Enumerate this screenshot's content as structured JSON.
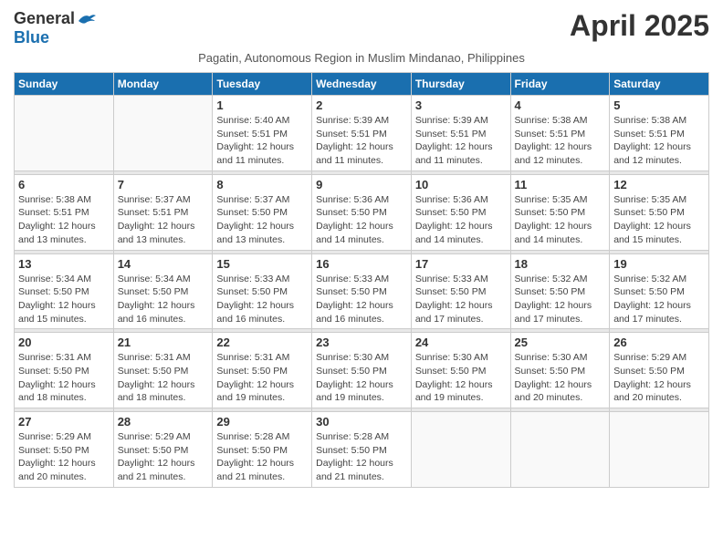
{
  "logo": {
    "general": "General",
    "blue": "Blue"
  },
  "title": "April 2025",
  "subtitle": "Pagatin, Autonomous Region in Muslim Mindanao, Philippines",
  "days_of_week": [
    "Sunday",
    "Monday",
    "Tuesday",
    "Wednesday",
    "Thursday",
    "Friday",
    "Saturday"
  ],
  "weeks": [
    [
      {
        "day": "",
        "sunrise": "",
        "sunset": "",
        "daylight": ""
      },
      {
        "day": "",
        "sunrise": "",
        "sunset": "",
        "daylight": ""
      },
      {
        "day": "1",
        "sunrise": "Sunrise: 5:40 AM",
        "sunset": "Sunset: 5:51 PM",
        "daylight": "Daylight: 12 hours and 11 minutes."
      },
      {
        "day": "2",
        "sunrise": "Sunrise: 5:39 AM",
        "sunset": "Sunset: 5:51 PM",
        "daylight": "Daylight: 12 hours and 11 minutes."
      },
      {
        "day": "3",
        "sunrise": "Sunrise: 5:39 AM",
        "sunset": "Sunset: 5:51 PM",
        "daylight": "Daylight: 12 hours and 11 minutes."
      },
      {
        "day": "4",
        "sunrise": "Sunrise: 5:38 AM",
        "sunset": "Sunset: 5:51 PM",
        "daylight": "Daylight: 12 hours and 12 minutes."
      },
      {
        "day": "5",
        "sunrise": "Sunrise: 5:38 AM",
        "sunset": "Sunset: 5:51 PM",
        "daylight": "Daylight: 12 hours and 12 minutes."
      }
    ],
    [
      {
        "day": "6",
        "sunrise": "Sunrise: 5:38 AM",
        "sunset": "Sunset: 5:51 PM",
        "daylight": "Daylight: 12 hours and 13 minutes."
      },
      {
        "day": "7",
        "sunrise": "Sunrise: 5:37 AM",
        "sunset": "Sunset: 5:51 PM",
        "daylight": "Daylight: 12 hours and 13 minutes."
      },
      {
        "day": "8",
        "sunrise": "Sunrise: 5:37 AM",
        "sunset": "Sunset: 5:50 PM",
        "daylight": "Daylight: 12 hours and 13 minutes."
      },
      {
        "day": "9",
        "sunrise": "Sunrise: 5:36 AM",
        "sunset": "Sunset: 5:50 PM",
        "daylight": "Daylight: 12 hours and 14 minutes."
      },
      {
        "day": "10",
        "sunrise": "Sunrise: 5:36 AM",
        "sunset": "Sunset: 5:50 PM",
        "daylight": "Daylight: 12 hours and 14 minutes."
      },
      {
        "day": "11",
        "sunrise": "Sunrise: 5:35 AM",
        "sunset": "Sunset: 5:50 PM",
        "daylight": "Daylight: 12 hours and 14 minutes."
      },
      {
        "day": "12",
        "sunrise": "Sunrise: 5:35 AM",
        "sunset": "Sunset: 5:50 PM",
        "daylight": "Daylight: 12 hours and 15 minutes."
      }
    ],
    [
      {
        "day": "13",
        "sunrise": "Sunrise: 5:34 AM",
        "sunset": "Sunset: 5:50 PM",
        "daylight": "Daylight: 12 hours and 15 minutes."
      },
      {
        "day": "14",
        "sunrise": "Sunrise: 5:34 AM",
        "sunset": "Sunset: 5:50 PM",
        "daylight": "Daylight: 12 hours and 16 minutes."
      },
      {
        "day": "15",
        "sunrise": "Sunrise: 5:33 AM",
        "sunset": "Sunset: 5:50 PM",
        "daylight": "Daylight: 12 hours and 16 minutes."
      },
      {
        "day": "16",
        "sunrise": "Sunrise: 5:33 AM",
        "sunset": "Sunset: 5:50 PM",
        "daylight": "Daylight: 12 hours and 16 minutes."
      },
      {
        "day": "17",
        "sunrise": "Sunrise: 5:33 AM",
        "sunset": "Sunset: 5:50 PM",
        "daylight": "Daylight: 12 hours and 17 minutes."
      },
      {
        "day": "18",
        "sunrise": "Sunrise: 5:32 AM",
        "sunset": "Sunset: 5:50 PM",
        "daylight": "Daylight: 12 hours and 17 minutes."
      },
      {
        "day": "19",
        "sunrise": "Sunrise: 5:32 AM",
        "sunset": "Sunset: 5:50 PM",
        "daylight": "Daylight: 12 hours and 17 minutes."
      }
    ],
    [
      {
        "day": "20",
        "sunrise": "Sunrise: 5:31 AM",
        "sunset": "Sunset: 5:50 PM",
        "daylight": "Daylight: 12 hours and 18 minutes."
      },
      {
        "day": "21",
        "sunrise": "Sunrise: 5:31 AM",
        "sunset": "Sunset: 5:50 PM",
        "daylight": "Daylight: 12 hours and 18 minutes."
      },
      {
        "day": "22",
        "sunrise": "Sunrise: 5:31 AM",
        "sunset": "Sunset: 5:50 PM",
        "daylight": "Daylight: 12 hours and 19 minutes."
      },
      {
        "day": "23",
        "sunrise": "Sunrise: 5:30 AM",
        "sunset": "Sunset: 5:50 PM",
        "daylight": "Daylight: 12 hours and 19 minutes."
      },
      {
        "day": "24",
        "sunrise": "Sunrise: 5:30 AM",
        "sunset": "Sunset: 5:50 PM",
        "daylight": "Daylight: 12 hours and 19 minutes."
      },
      {
        "day": "25",
        "sunrise": "Sunrise: 5:30 AM",
        "sunset": "Sunset: 5:50 PM",
        "daylight": "Daylight: 12 hours and 20 minutes."
      },
      {
        "day": "26",
        "sunrise": "Sunrise: 5:29 AM",
        "sunset": "Sunset: 5:50 PM",
        "daylight": "Daylight: 12 hours and 20 minutes."
      }
    ],
    [
      {
        "day": "27",
        "sunrise": "Sunrise: 5:29 AM",
        "sunset": "Sunset: 5:50 PM",
        "daylight": "Daylight: 12 hours and 20 minutes."
      },
      {
        "day": "28",
        "sunrise": "Sunrise: 5:29 AM",
        "sunset": "Sunset: 5:50 PM",
        "daylight": "Daylight: 12 hours and 21 minutes."
      },
      {
        "day": "29",
        "sunrise": "Sunrise: 5:28 AM",
        "sunset": "Sunset: 5:50 PM",
        "daylight": "Daylight: 12 hours and 21 minutes."
      },
      {
        "day": "30",
        "sunrise": "Sunrise: 5:28 AM",
        "sunset": "Sunset: 5:50 PM",
        "daylight": "Daylight: 12 hours and 21 minutes."
      },
      {
        "day": "",
        "sunrise": "",
        "sunset": "",
        "daylight": ""
      },
      {
        "day": "",
        "sunrise": "",
        "sunset": "",
        "daylight": ""
      },
      {
        "day": "",
        "sunrise": "",
        "sunset": "",
        "daylight": ""
      }
    ]
  ]
}
